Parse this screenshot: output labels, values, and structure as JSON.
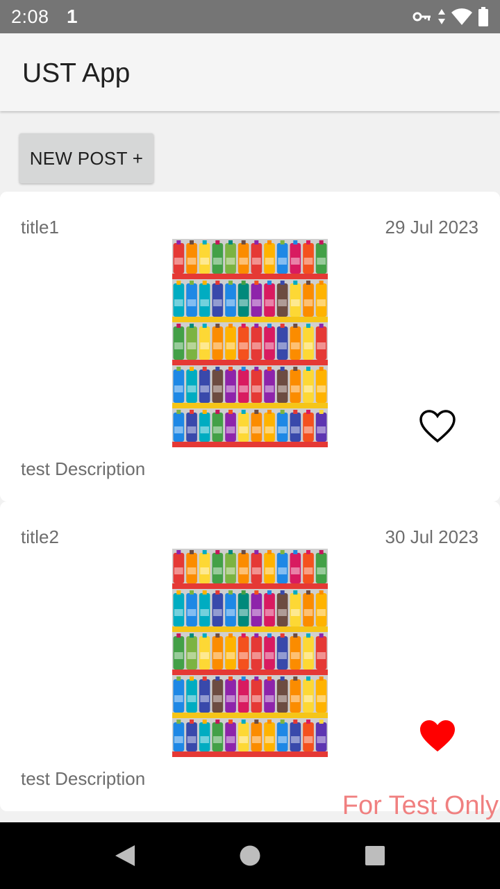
{
  "status_bar": {
    "time": "2:08",
    "notification_glyph": "1",
    "icons": [
      "vpn-key-icon",
      "data-arrows-icon",
      "wifi-icon",
      "battery-icon"
    ]
  },
  "app_bar": {
    "title": "UST App"
  },
  "actions": {
    "new_post_label": "NEW POST +"
  },
  "posts": [
    {
      "title": "title1",
      "date": "29 Jul 2023",
      "description": "test Description",
      "image": "store-shelves-photo",
      "liked": false
    },
    {
      "title": "title2",
      "date": "30 Jul 2023",
      "description": "test Description",
      "image": "store-shelves-photo",
      "liked": true
    }
  ],
  "watermark": "For Test Only",
  "nav_bar": {
    "buttons": [
      "back-icon",
      "home-icon",
      "recents-icon"
    ]
  },
  "colors": {
    "heart_liked": "#ff0000",
    "heart_outline": "#000000",
    "watermark": "#f08080"
  }
}
